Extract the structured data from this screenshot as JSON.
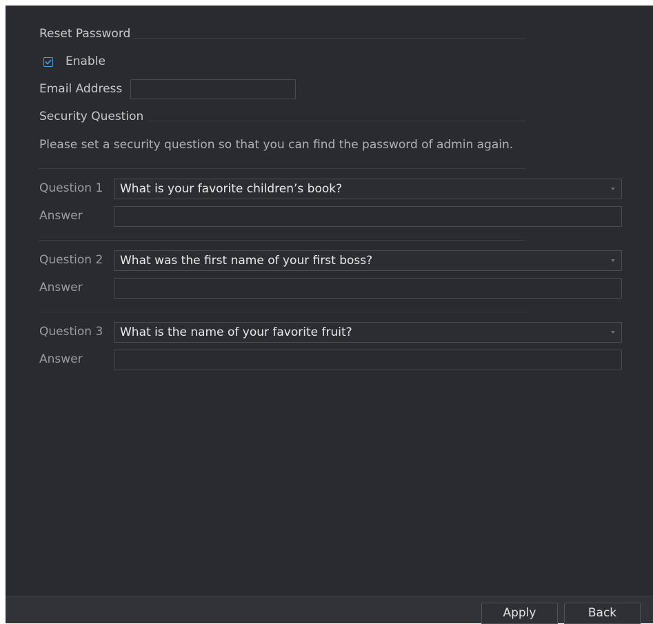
{
  "reset_password": {
    "title": "Reset Password",
    "enable_label": "Enable",
    "enable_checked": true,
    "email_label": "Email Address",
    "email_value": ""
  },
  "security_question": {
    "title": "Security Question",
    "info": "Please set a security question so that you can find the password of admin again.",
    "questions": [
      {
        "label": "Question 1",
        "value": "What is your favorite children’s book?",
        "answer_label": "Answer",
        "answer_value": ""
      },
      {
        "label": "Question 2",
        "value": "What was the first name of your first boss?",
        "answer_label": "Answer",
        "answer_value": ""
      },
      {
        "label": "Question 3",
        "value": "What is the name of your favorite fruit?",
        "answer_label": "Answer",
        "answer_value": ""
      }
    ]
  },
  "footer": {
    "apply_label": "Apply",
    "back_label": "Back"
  },
  "colors": {
    "background": "#2a2b30",
    "accent": "#3aa7e3",
    "bottom_bar": "#323339"
  }
}
